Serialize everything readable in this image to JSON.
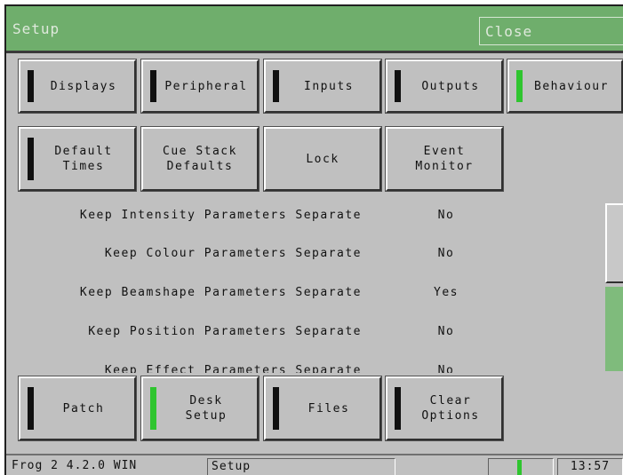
{
  "window": {
    "title": "Setup",
    "close_label": "Close"
  },
  "tabs_row1": [
    {
      "label": "Displays",
      "indicator": "off"
    },
    {
      "label": "Peripheral",
      "indicator": "off"
    },
    {
      "label": "Inputs",
      "indicator": "off"
    },
    {
      "label": "Outputs",
      "indicator": "off"
    },
    {
      "label": "Behaviour",
      "indicator": "on"
    }
  ],
  "tabs_row2": [
    {
      "label": "Default\nTimes",
      "indicator": "off"
    },
    {
      "label": "Cue Stack\nDefaults"
    },
    {
      "label": "Lock"
    },
    {
      "label": "Event\nMonitor"
    }
  ],
  "settings": [
    {
      "label": "Keep Intensity Parameters Separate",
      "value": "No"
    },
    {
      "label": "Keep Colour Parameters Separate",
      "value": "No"
    },
    {
      "label": "Keep Beamshape Parameters Separate",
      "value": "Yes"
    },
    {
      "label": "Keep Position Parameters Separate",
      "value": "No"
    },
    {
      "label": "Keep Effect Parameters Separate",
      "value": "No"
    }
  ],
  "bottom_buttons": [
    {
      "label": "Patch",
      "indicator": "off"
    },
    {
      "label": "Desk\nSetup",
      "indicator": "on"
    },
    {
      "label": "Files",
      "indicator": "off"
    },
    {
      "label": "Clear\nOptions",
      "indicator": "off"
    }
  ],
  "status": {
    "version": "Frog 2 4.2.0 WIN",
    "current_screen": "Setup",
    "time": "13:57"
  },
  "colors": {
    "titlebar": "#6fae6c",
    "indicator_on": "#2fc52f",
    "indicator_off": "#101010",
    "panel": "#c0c0c0"
  }
}
